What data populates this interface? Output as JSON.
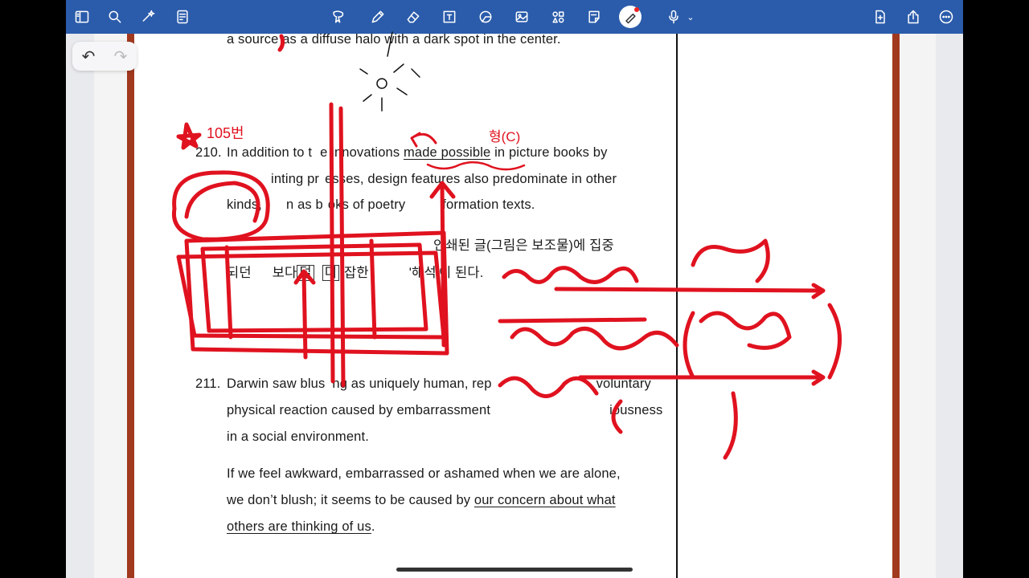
{
  "toolbar": {
    "left_icons": [
      "sidebar-icon",
      "search-icon",
      "sparkle-icon",
      "document-list-icon"
    ],
    "center_icons": [
      "lasso-select-icon",
      "pen-icon",
      "eraser-icon",
      "text-box-icon",
      "shape-icon",
      "image-icon",
      "elements-icon",
      "sticky-note-icon",
      "laser-pointer-icon",
      "microphone-icon"
    ],
    "right_icons": [
      "add-page-icon",
      "share-icon",
      "more-icon"
    ],
    "accent_color": "#2b5cab"
  },
  "undo": {
    "undo_glyph": "↶",
    "redo_glyph": "↷"
  },
  "document": {
    "line_top": "a source as a diffuse halo with a dark spot in the center.",
    "q210": {
      "number": "210.",
      "l1a": "In addition to t",
      "l1b": "e innovations ",
      "l1c": "made possible",
      "l1d": " in picture books by",
      "l2a": "inting pr",
      "l2b": "esses, design features also predominate in other",
      "l3a": "kinds,",
      "l3b": "n as b",
      "l3c": "oks of poetry",
      "l3d": "formation texts.",
      "k1": "인쇄된 글(그림은 보조물)에 집중",
      "k2a": "되던",
      "k2b": "보다",
      "k2box1": "덜",
      "k2box2": "더",
      "k2c": "잡한",
      "k2d": "'해석'이 된다."
    },
    "q211": {
      "number": "211.",
      "l1a": "Darwin saw blus",
      "l1b": "ng as uniquely human, rep",
      "l1c": "voluntary",
      "l2a": "physical reaction caused by embarrassment",
      "l2b": "iousness",
      "l3": "in a social environment.",
      "p2l1": "If we feel awkward, embarrassed or ashamed when we are alone,",
      "p2l2a": "we don’t blush; it seems to be caused by ",
      "p2l2b": "our concern about what",
      "p2l3a": "others are thinking of us",
      "p2l3b": "."
    }
  },
  "annotations": {
    "ink_color": "#e0121f",
    "star_note": "105번",
    "made_possible_note": "형(C)"
  }
}
